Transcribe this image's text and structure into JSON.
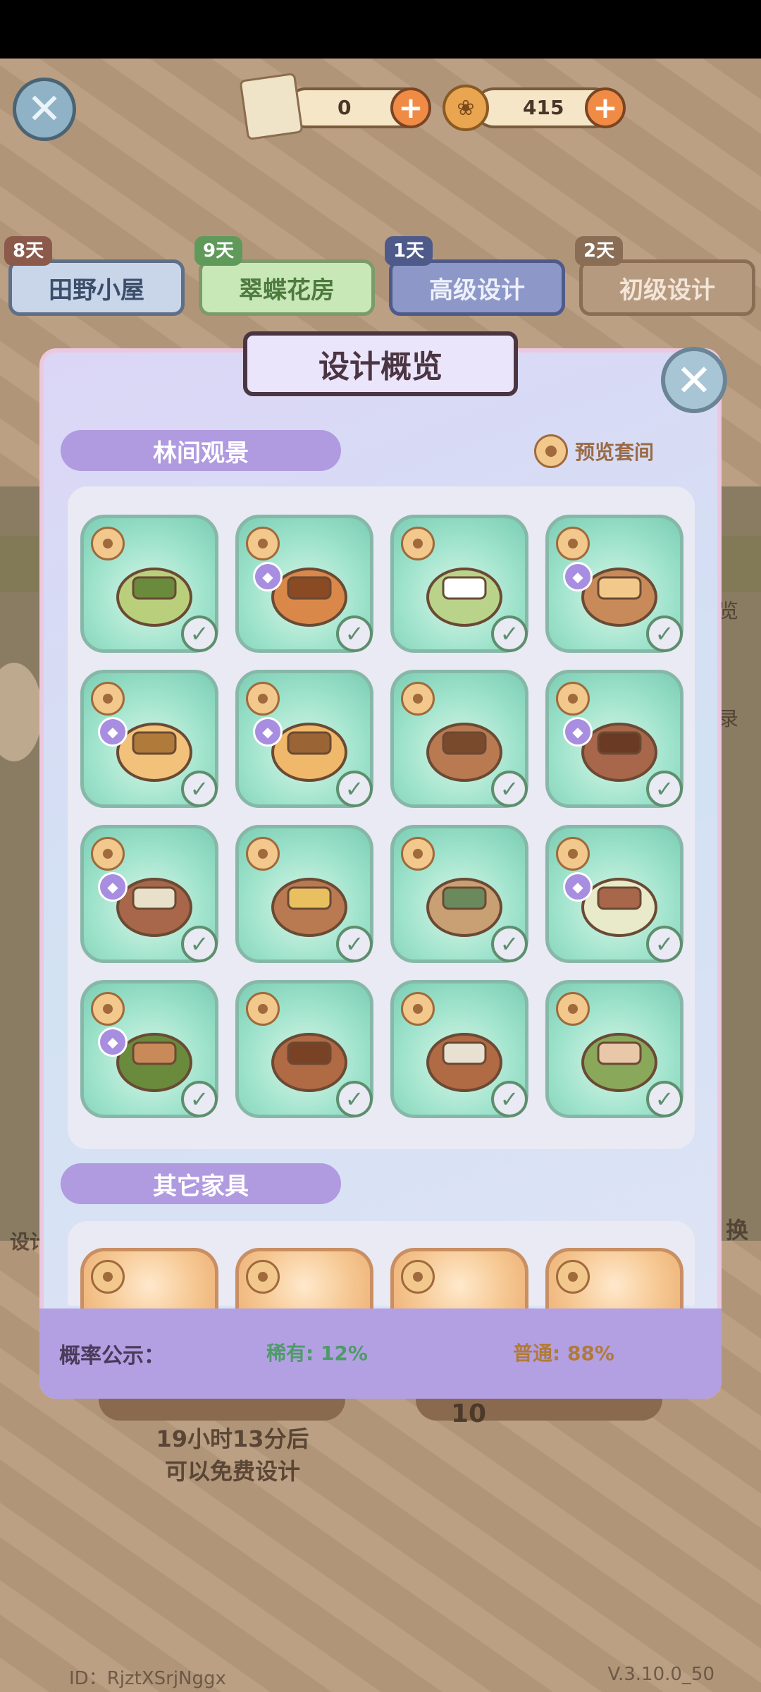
{
  "top_bar": {
    "scroll_count": "0",
    "coin_count": "415"
  },
  "categories": [
    {
      "days": "8天",
      "label": "田野小屋"
    },
    {
      "days": "9天",
      "label": "翠蝶花房"
    },
    {
      "days": "1天",
      "label": "高级设计"
    },
    {
      "days": "2天",
      "label": "初级设计"
    }
  ],
  "modal": {
    "title": "设计概览",
    "section1_title": "林间观景",
    "preview_label": "预览套间",
    "section2_title": "其它家具",
    "items": [
      {
        "name": "books",
        "tag": false
      },
      {
        "name": "bread",
        "tag": true
      },
      {
        "name": "flower-rug",
        "tag": false
      },
      {
        "name": "bed",
        "tag": true
      },
      {
        "name": "armchair-cushion",
        "tag": true
      },
      {
        "name": "armchair",
        "tag": true
      },
      {
        "name": "nightstand",
        "tag": false
      },
      {
        "name": "tall-cabinet",
        "tag": true
      },
      {
        "name": "glass-cabinet",
        "tag": true
      },
      {
        "name": "table",
        "tag": false
      },
      {
        "name": "picture-wall",
        "tag": false
      },
      {
        "name": "lamp",
        "tag": true
      },
      {
        "name": "curtain",
        "tag": true
      },
      {
        "name": "bench",
        "tag": false
      },
      {
        "name": "glass-box",
        "tag": false
      },
      {
        "name": "hedge",
        "tag": false
      }
    ],
    "footer": {
      "label": "概率公示：",
      "rare": "稀有: 12%",
      "common": "普通: 88%"
    }
  },
  "background": {
    "free_line1": "19小时13分后",
    "free_line2": "可以免费设计",
    "ten": "10",
    "id_text": "ID：RjztXSrjNggx",
    "version": "V.3.10.0_50",
    "side_left": "设计",
    "side_right1": "览",
    "side_right2": "录",
    "side_right3": "换"
  },
  "colors": {
    "accent_purple": "#b09ae0",
    "item_green": "#9fe3cc",
    "item_orange": "#f6c893",
    "rare_green": "#4f9a6a",
    "common_orange": "#b07a3a"
  }
}
